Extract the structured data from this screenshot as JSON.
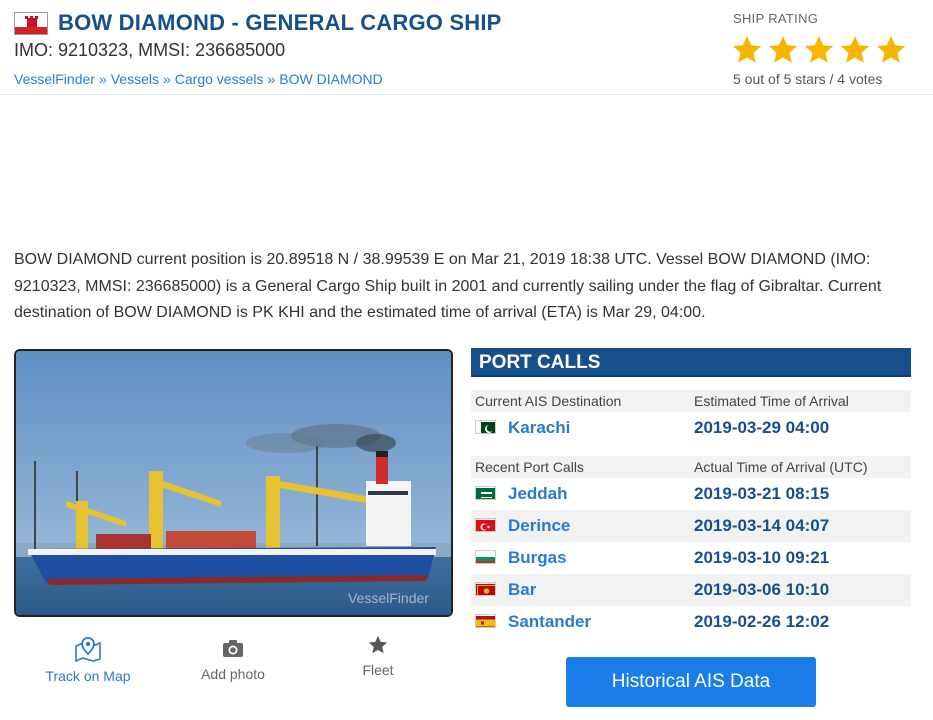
{
  "header": {
    "flag_icon": "gibraltar-flag-icon",
    "title": "BOW DIAMOND - GENERAL CARGO SHIP",
    "ids": "IMO: 9210323, MMSI: 236685000",
    "breadcrumb": [
      "VesselFinder",
      "Vessels",
      "Cargo vessels",
      "BOW DIAMOND"
    ],
    "breadcrumb_separator": "»"
  },
  "rating": {
    "label": "SHIP RATING",
    "stars_filled": 5,
    "stars_total": 5,
    "star_color": "#f7b500",
    "summary": "5 out of 5 stars / 4 votes"
  },
  "description": "BOW DIAMOND current position is 20.89518 N / 38.99539 E on Mar 21, 2019 18:38 UTC. Vessel BOW DIAMOND (IMO: 9210323, MMSI: 236685000) is a General Cargo Ship built in 2001 and currently sailing under the flag of Gibraltar. Current destination of BOW DIAMOND is PK KHI and the estimated time of arrival (ETA) is Mar 29, 04:00.",
  "photo": {
    "icon": "ship-photo",
    "watermark": "VesselFinder"
  },
  "actions": [
    {
      "label": "Track on Map",
      "icon": "map-pin-icon"
    },
    {
      "label": "Add photo",
      "icon": "camera-icon"
    },
    {
      "label": "Fleet",
      "icon": "star-icon"
    }
  ],
  "port_calls": {
    "title": "PORT CALLS",
    "destination_headers": [
      "Current AIS Destination",
      "Estimated Time of Arrival"
    ],
    "destination": {
      "port": "Karachi",
      "flag": "pakistan-flag-icon",
      "time": "2019-03-29 04:00"
    },
    "recent_headers": [
      "Recent Port Calls",
      "Actual Time of Arrival (UTC)"
    ],
    "recent": [
      {
        "port": "Jeddah",
        "flag": "saudi-arabia-flag-icon",
        "time": "2019-03-21 08:15"
      },
      {
        "port": "Derince",
        "flag": "turkey-flag-icon",
        "time": "2019-03-14 04:07"
      },
      {
        "port": "Burgas",
        "flag": "bulgaria-flag-icon",
        "time": "2019-03-10 09:21"
      },
      {
        "port": "Bar",
        "flag": "montenegro-flag-icon",
        "time": "2019-03-06 10:10"
      },
      {
        "port": "Santander",
        "flag": "spain-flag-icon",
        "time": "2019-02-26 12:02"
      }
    ]
  },
  "historical_button": "Historical AIS Data",
  "colors": {
    "title_blue": "#174f8c",
    "link_blue": "#2a7bd0",
    "button_blue": "#1a7de8"
  }
}
